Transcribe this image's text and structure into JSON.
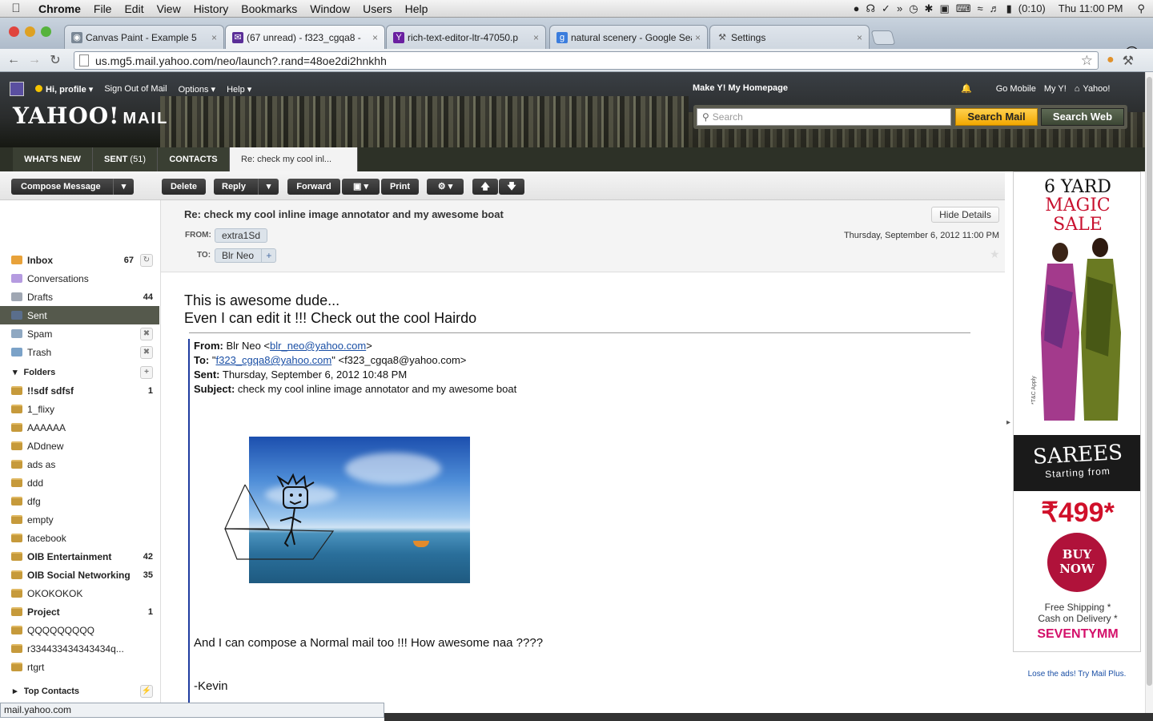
{
  "menubar": {
    "items": [
      "Chrome",
      "File",
      "Edit",
      "View",
      "History",
      "Bookmarks",
      "Window",
      "Users",
      "Help"
    ],
    "battery": "(0:10)",
    "clock": "Thu 11:00 PM"
  },
  "tabs": [
    {
      "title": "Canvas Paint - Example 5",
      "icon": "globe-icon"
    },
    {
      "title": "(67 unread) - f323_cgqa8 -",
      "icon": "yahoo-mail-icon"
    },
    {
      "title": "rich-text-editor-ltr-47050.p",
      "icon": "yahoo-icon"
    },
    {
      "title": "natural scenery - Google Sea",
      "icon": "google-icon"
    },
    {
      "title": "Settings",
      "icon": "wrench-icon"
    }
  ],
  "address": "us.mg5.mail.yahoo.com/neo/launch?.rand=48oe2di2hnkhh",
  "yahoo": {
    "greeting": "Hi, profile",
    "signout": "Sign Out of Mail",
    "options": "Options",
    "help": "Help",
    "logo": "YAHOO!",
    "logo_suffix": "MAIL",
    "make_home": "Make Y! My Homepage",
    "go_mobile": "Go Mobile",
    "my_y": "My Y!",
    "yahoo_link": "Yahoo!",
    "search_placeholder": "Search",
    "search_mail": "Search Mail",
    "search_web": "Search Web"
  },
  "navtabs": {
    "whats_new": "WHAT'S NEW",
    "sent": "SENT",
    "sent_count": "(51)",
    "contacts": "CONTACTS",
    "open_msg": "Re: check my cool inl..."
  },
  "actions": {
    "compose": "Compose Message",
    "delete": "Delete",
    "reply": "Reply",
    "forward": "Forward",
    "print": "Print"
  },
  "sidebar": {
    "items": [
      {
        "label": "Inbox",
        "count": "67",
        "icon": "inbox-icon"
      },
      {
        "label": "Conversations",
        "count": "",
        "icon": "conversations-icon"
      },
      {
        "label": "Drafts",
        "count": "44",
        "icon": "drafts-icon"
      },
      {
        "label": "Sent",
        "count": "",
        "icon": "sent-icon"
      },
      {
        "label": "Spam",
        "count": "",
        "icon": "spam-icon"
      },
      {
        "label": "Trash",
        "count": "",
        "icon": "trash-icon"
      }
    ],
    "folders_heading": "Folders",
    "folders": [
      {
        "label": "!!sdf sdfsf",
        "count": "1",
        "bold": true
      },
      {
        "label": "1_flixy",
        "count": "",
        "bold": false
      },
      {
        "label": "AAAAAA",
        "count": "",
        "bold": false
      },
      {
        "label": "ADdnew",
        "count": "",
        "bold": false
      },
      {
        "label": "ads as",
        "count": "",
        "bold": false
      },
      {
        "label": "ddd",
        "count": "",
        "bold": false
      },
      {
        "label": "dfg",
        "count": "",
        "bold": false
      },
      {
        "label": "empty",
        "count": "",
        "bold": false
      },
      {
        "label": "facebook",
        "count": "",
        "bold": false
      },
      {
        "label": "OIB Entertainment",
        "count": "42",
        "bold": true
      },
      {
        "label": "OIB Social Networking",
        "count": "35",
        "bold": true
      },
      {
        "label": "OKOKOKOK",
        "count": "",
        "bold": false
      },
      {
        "label": "Project",
        "count": "1",
        "bold": true
      },
      {
        "label": "QQQQQQQQQ",
        "count": "",
        "bold": false
      },
      {
        "label": "r334433434343434q...",
        "count": "",
        "bold": false
      },
      {
        "label": "rtgrt",
        "count": "",
        "bold": false
      }
    ],
    "top_contacts": "Top Contacts"
  },
  "message": {
    "subject": "Re: check my cool inline image annotator and my awesome boat",
    "hide_details": "Hide Details",
    "from_label": "FROM:",
    "from": "extra1Sd",
    "to_label": "TO:",
    "to": "Blr Neo",
    "date": "Thursday, September 6, 2012 11:00 PM",
    "body_line1": "This is awesome dude...",
    "body_line2": "Even I can edit it  !!! Check out the cool Hairdo",
    "q_from_label": "From:",
    "q_from_name": "Blr Neo <",
    "q_from_email": "blr_neo@yahoo.com",
    "q_from_end": ">",
    "q_to_label": "To:",
    "q_to_start": "\"",
    "q_to_email": "f323_cgqa8@yahoo.com",
    "q_to_end": "\" <f323_cgqa8@yahoo.com>",
    "q_sent_label": "Sent:",
    "q_sent": "Thursday, September 6, 2012 10:48 PM",
    "q_subject_label": "Subject:",
    "q_subject": "check my cool inline image annotator and my awesome boat",
    "body_line3": "And I can compose a Normal mail too !!! How awesome naa ????",
    "signature": "-Kevin"
  },
  "ad": {
    "line1": "6 YARD",
    "line2": "MAGIC",
    "line3": "SALE",
    "sarees": "SAREES",
    "starting": "Starting from",
    "price": "₹499*",
    "buy1": "BUY",
    "buy2": "NOW",
    "shipping": "Free Shipping *",
    "cod": "Cash on Delivery *",
    "brand": "SEVENTYMM",
    "tc": "*T&C Apply",
    "lose_ads": "Lose the ads! Try Mail Plus."
  },
  "status_text": "mail.yahoo.com"
}
